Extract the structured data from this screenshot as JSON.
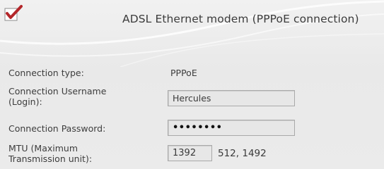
{
  "header": {
    "title": "ADSL Ethernet modem (PPPoE connection)",
    "checkbox_checked": true
  },
  "form": {
    "connection_type": {
      "label": "Connection type:",
      "value": "PPPoE"
    },
    "username": {
      "label_line1": "Connection Username",
      "label_line2": "(Login):",
      "value": "Hercules"
    },
    "password": {
      "label": "Connection Password:",
      "value": "••••••••"
    },
    "mtu": {
      "label_line1": "MTU (Maximum",
      "label_line2": "Transmission unit):",
      "value": "1392",
      "hint": "512, 1492"
    }
  },
  "colors": {
    "check_red": "#b3262a",
    "background": "#ececec"
  }
}
